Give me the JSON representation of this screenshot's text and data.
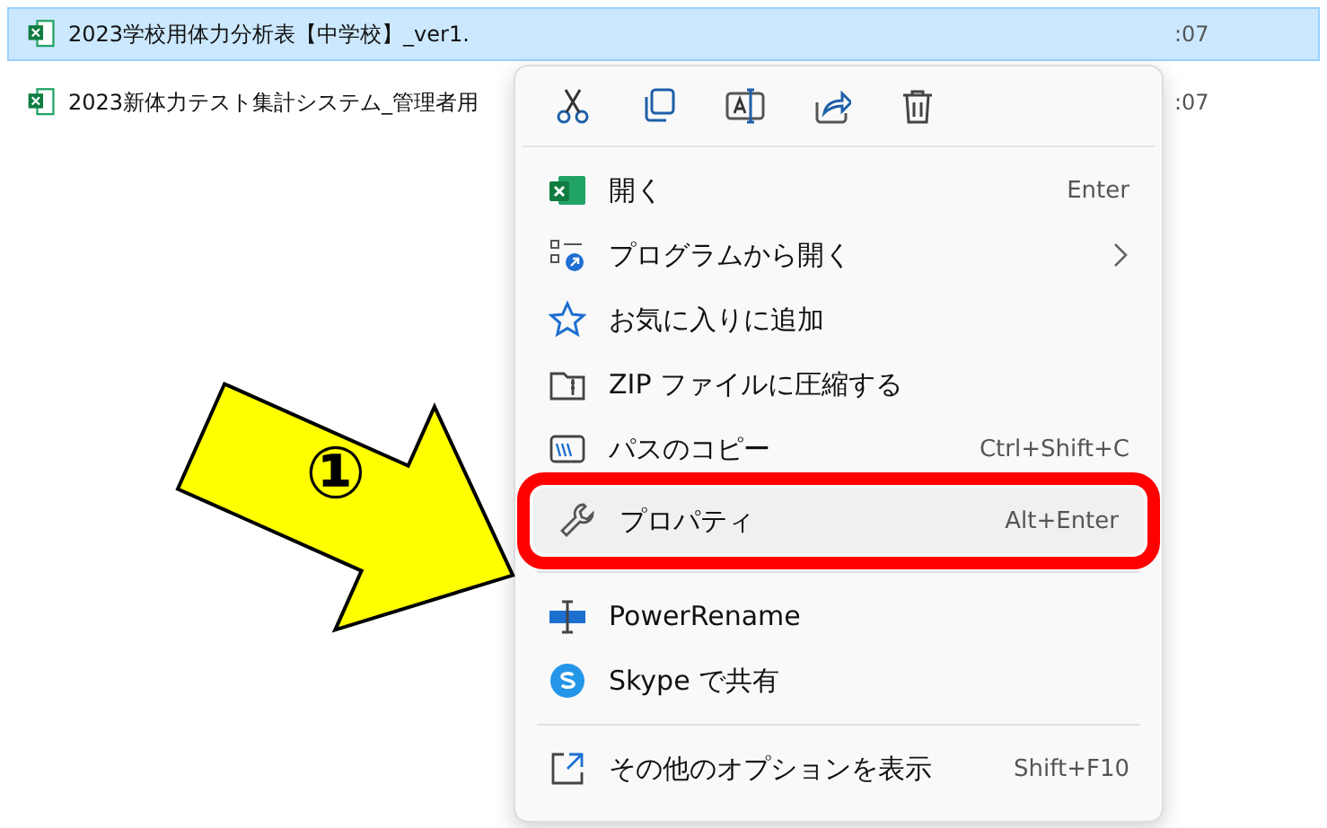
{
  "files": [
    {
      "name": "2023学校用体力分析表【中学校】_ver1.",
      "date": ":07",
      "selected": true
    },
    {
      "name": "2023新体力テスト集計システム_管理者用",
      "date": ":07",
      "selected": false
    }
  ],
  "menu": {
    "items": [
      {
        "kind": "item",
        "label": "開く",
        "shortcut": "Enter",
        "submenu": false,
        "highlighted": false
      },
      {
        "kind": "item",
        "label": "プログラムから開く",
        "submenu": true,
        "highlighted": false
      },
      {
        "kind": "item",
        "label": "お気に入りに追加",
        "submenu": false,
        "highlighted": false
      },
      {
        "kind": "item",
        "label": "ZIP ファイルに圧縮する",
        "submenu": false,
        "highlighted": false
      },
      {
        "kind": "item",
        "label": "パスのコピー",
        "shortcut": "Ctrl+Shift+C",
        "submenu": false,
        "highlighted": false
      },
      {
        "kind": "item",
        "label": "プロパティ",
        "shortcut": "Alt+Enter",
        "submenu": false,
        "highlighted": true
      },
      {
        "kind": "separator"
      },
      {
        "kind": "item",
        "label": "PowerRename",
        "submenu": false,
        "highlighted": false
      },
      {
        "kind": "item",
        "label": "Skype で共有",
        "submenu": false,
        "highlighted": false
      },
      {
        "kind": "separator"
      },
      {
        "kind": "item",
        "label": "その他のオプションを表示",
        "shortcut": "Shift+F10",
        "submenu": false,
        "highlighted": false
      }
    ]
  },
  "callout": {
    "label": "①"
  }
}
